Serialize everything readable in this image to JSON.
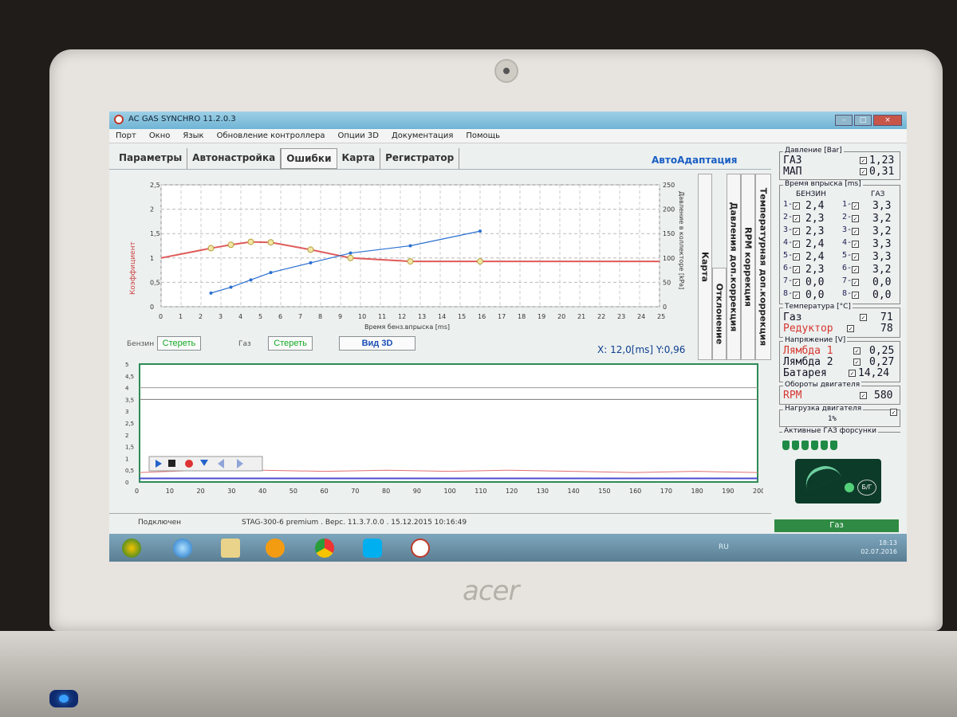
{
  "window": {
    "title": "AC GAS SYNCHRO 11.2.0.3",
    "controls": [
      "–",
      "□",
      "×"
    ]
  },
  "menu": [
    "Порт",
    "Окно",
    "Язык",
    "Обновление контроллера",
    "Опции 3D",
    "Документация",
    "Помощь"
  ],
  "tabs": [
    "Параметры",
    "Автонастройка",
    "Ошибки",
    "Карта",
    "Регистратор"
  ],
  "auto_adapt": "АвтоАдаптация",
  "side_tabs": [
    "Карта",
    "Отклонение",
    "Давления доп.коррекция",
    "RPM коррекция",
    "Температурная доп.коррекция"
  ],
  "map_chart": {
    "ylabel": "Коэффициент",
    "xlabel": "Время бенз.впрыска [ms]",
    "y2label": "Давление в коллекторе [kPa]",
    "yticks": [
      "2,5",
      "2",
      "1,5",
      "1",
      "0,5",
      "0"
    ],
    "y2ticks": [
      "250",
      "200",
      "150",
      "100",
      "50",
      "0"
    ],
    "xticks": [
      "0",
      "1",
      "2",
      "3",
      "4",
      "5",
      "6",
      "7",
      "8",
      "9",
      "10",
      "11",
      "12",
      "13",
      "14",
      "15",
      "16",
      "17",
      "18",
      "19",
      "20",
      "21",
      "22",
      "23",
      "24",
      "25"
    ]
  },
  "chart_data": [
    {
      "type": "line",
      "xlabel": "Время бенз.впрыска [ms]",
      "ylabel": "Коэффициент",
      "xlim": [
        0,
        25
      ],
      "ylim": [
        0,
        2.5
      ],
      "y2lim": [
        0,
        250
      ],
      "x": [
        2.5,
        3.5,
        4.5,
        5.5,
        7.5,
        9.5,
        12.5,
        16
      ],
      "series": [
        {
          "values": [
            1.2,
            1.27,
            1.33,
            1.32,
            1.17,
            1.0,
            0.93,
            0.93
          ],
          "color": "#e05a5a"
        },
        {
          "values": [
            0.28,
            0.4,
            0.55,
            0.7,
            0.9,
            1.1,
            1.25,
            1.55
          ],
          "color": "#2a6fd1",
          "axis": "y2_scatter"
        }
      ]
    },
    {
      "type": "line",
      "xlim": [
        0,
        200
      ],
      "ylim": [
        0,
        5
      ],
      "x": [
        0,
        20,
        40,
        60,
        80,
        100,
        120,
        140,
        160,
        180,
        200
      ],
      "series": [
        {
          "values": [
            0.4,
            0.5,
            0.5,
            0.45,
            0.5,
            0.45,
            0.5,
            0.45,
            0.4,
            0.45,
            0.4
          ],
          "color": "#e07070"
        },
        {
          "values": [
            0.15,
            0.15,
            0.15,
            0.15,
            0.15,
            0.15,
            0.15,
            0.15,
            0.15,
            0.15,
            0.15
          ],
          "color": "#4b4bd0"
        }
      ]
    }
  ],
  "controls": {
    "petrol_label": "Бензин",
    "clear": "Стереть",
    "gas_label": "Газ",
    "view3d": "Вид 3D",
    "coords": "X: 12,0[ms] Y:0,96"
  },
  "osc_chart": {
    "yticks": [
      "5",
      "4,5",
      "4",
      "3,5",
      "3",
      "2,5",
      "2",
      "1,5",
      "1",
      "0,5",
      "0"
    ],
    "xticks": [
      "0",
      "10",
      "20",
      "30",
      "40",
      "50",
      "60",
      "70",
      "80",
      "90",
      "100",
      "110",
      "120",
      "130",
      "140",
      "150",
      "160",
      "170",
      "180",
      "190",
      "200"
    ]
  },
  "pressure": {
    "title": "Давление [Bar]",
    "items": [
      {
        "label": "ГАЗ",
        "value": "1,23"
      },
      {
        "label": "МАП",
        "value": "0,31"
      }
    ]
  },
  "injection": {
    "title": "Время впрыска [ms]",
    "petrol_header": "БЕНЗИН",
    "gas_header": "ГАЗ",
    "rows": [
      {
        "n": "1",
        "petrol": "2,4",
        "gas": "3,3"
      },
      {
        "n": "2",
        "petrol": "2,3",
        "gas": "3,2"
      },
      {
        "n": "3",
        "petrol": "2,3",
        "gas": "3,2"
      },
      {
        "n": "4",
        "petrol": "2,4",
        "gas": "3,3"
      },
      {
        "n": "5",
        "petrol": "2,4",
        "gas": "3,3"
      },
      {
        "n": "6",
        "petrol": "2,3",
        "gas": "3,2"
      },
      {
        "n": "7",
        "petrol": "0,0",
        "gas": "0,0"
      },
      {
        "n": "8",
        "petrol": "0,0",
        "gas": "0,0"
      }
    ]
  },
  "temperature": {
    "title": "Температура [°C]",
    "items": [
      {
        "label": "Газ",
        "value": "71"
      },
      {
        "label": "Редуктор",
        "value": "78"
      }
    ]
  },
  "voltage": {
    "title": "Напряжение [V]",
    "items": [
      {
        "label": "Лямбда 1",
        "value": "0,25"
      },
      {
        "label": "Лямбда 2",
        "value": "0,27"
      },
      {
        "label": "Батарея",
        "value": "14,24"
      }
    ]
  },
  "rpm": {
    "title": "Обороты двигателя",
    "label": "RPM",
    "value": "580"
  },
  "load": {
    "title": "Нагрузка двигателя",
    "value": "1%"
  },
  "injectors": {
    "title": "Активные ГАЗ форсунки",
    "count": 6
  },
  "switch_label": "Б/Г",
  "gas_mode": "Газ",
  "status": {
    "connected": "Подключен",
    "info": "STAG-300-6 premium . Верс. 11.3.7.0.0 . 15.12.2015 10:16:49"
  },
  "taskbar": {
    "lang": "RU",
    "time": "18:13",
    "date": "02.07.2016"
  }
}
